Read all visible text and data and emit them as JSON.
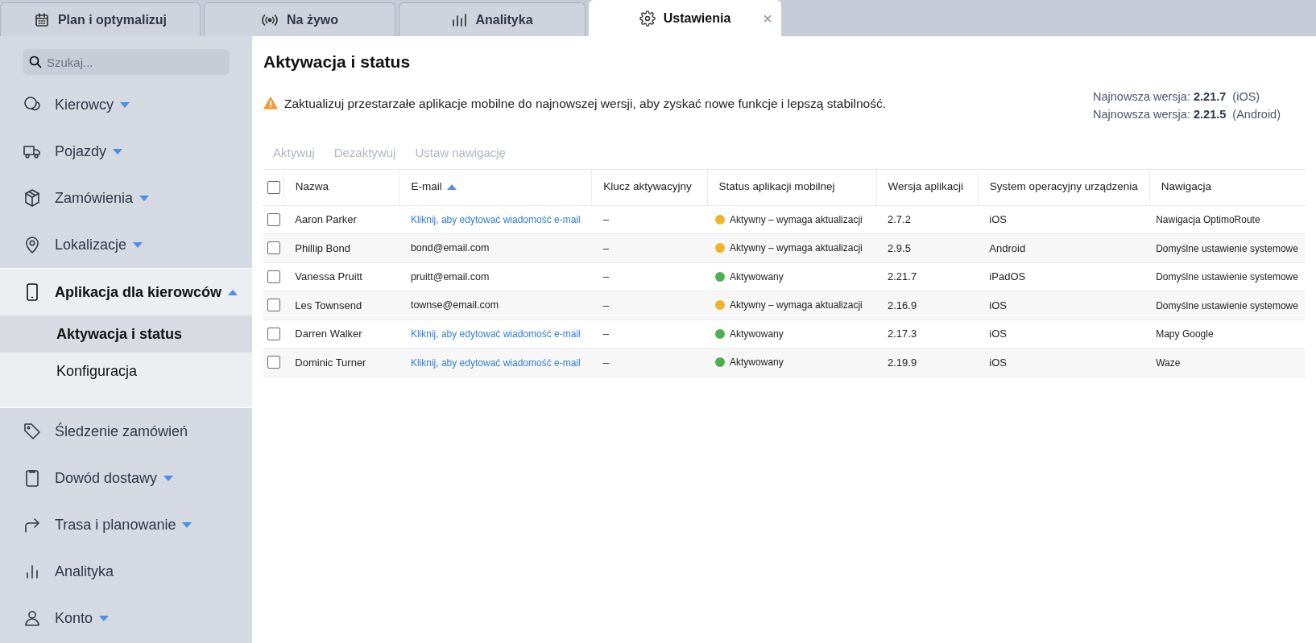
{
  "tabs": [
    {
      "label": "Plan i optymalizuj",
      "selected": false
    },
    {
      "label": "Na żywo",
      "selected": false
    },
    {
      "label": "Analityka",
      "selected": false
    },
    {
      "label": "Ustawienia",
      "selected": true,
      "close": "×"
    }
  ],
  "sidebar": {
    "search": {
      "placeholder": "Szukaj..."
    },
    "items": [
      {
        "label": "Kierowcy",
        "submenu": true,
        "expanded": false
      },
      {
        "label": "Pojazdy",
        "submenu": true,
        "expanded": false
      },
      {
        "label": "Zamówienia",
        "submenu": true,
        "expanded": false
      },
      {
        "label": "Lokalizacje",
        "submenu": true,
        "expanded": false
      },
      {
        "label": "Aplikacja dla kierowców",
        "submenu": true,
        "expanded": true,
        "children": [
          {
            "label": "Aktywacja i status",
            "selected": true
          },
          {
            "label": "Konfiguracja",
            "selected": false
          }
        ]
      },
      {
        "label": "Śledzenie zamówień",
        "submenu": false,
        "expanded": false
      },
      {
        "label": "Dowód dostawy",
        "submenu": true,
        "expanded": false
      },
      {
        "label": "Trasa i planowanie",
        "submenu": true,
        "expanded": false
      },
      {
        "label": "Analityka",
        "submenu": false,
        "expanded": false
      },
      {
        "label": "Konto",
        "submenu": true,
        "expanded": false
      }
    ]
  },
  "page": {
    "title": "Aktywacja i status",
    "warning": "Zaktualizuj przestarzałe aplikacje mobilne do najnowszej wersji, aby zyskać nowe funkcje i lepszą stabilność.",
    "versions": [
      "Najnowsza wersja: **2.21.7** (iOS)",
      "Najnowsza wersja: **2.21.5** (Android)"
    ],
    "actions": [
      {
        "label": "Aktywuj",
        "disabled": true
      },
      {
        "label": "Dezaktywuj",
        "disabled": true
      },
      {
        "label": "Ustaw nawigację",
        "disabled": true
      }
    ]
  },
  "table": {
    "select_all_checked": false,
    "columns": [
      {
        "label": "Nazwa",
        "sorted": false
      },
      {
        "label": "E-mail",
        "sorted": true
      },
      {
        "label": "Klucz aktywacyjny",
        "sorted": false
      },
      {
        "label": "Status aplikacji mobilnej",
        "sorted": false
      },
      {
        "label": "Wersja aplikacji",
        "sorted": false
      },
      {
        "label": "System operacyjny urządzenia",
        "sorted": false
      },
      {
        "label": "Nawigacja",
        "sorted": false
      }
    ],
    "rows": [
      {
        "checked": false,
        "name": "Aaron Parker",
        "email": {
          "text": "Kliknij, aby edytować wiadomość e-mail",
          "kind": "link"
        },
        "key": "–",
        "status": "Aktywny – wymaga aktualizacji",
        "color": "#f0b429",
        "version": "2.7.2",
        "os": "iOS",
        "navigation": "Nawigacja OptimoRoute"
      },
      {
        "checked": false,
        "name": "Phillip Bond",
        "email": {
          "text": "bond@email.com",
          "kind": "text"
        },
        "key": "–",
        "status": "Aktywny – wymaga aktualizacji",
        "color": "#f0b429",
        "version": "2.9.5",
        "os": "Android",
        "navigation": "Domyślne ustawienie systemowe"
      },
      {
        "checked": false,
        "name": "Vanessa Pruitt",
        "email": {
          "text": "pruitt@email.com",
          "kind": "text"
        },
        "key": "–",
        "status": "Aktywowany",
        "color": "#4caf50",
        "version": "2.21.7",
        "os": "iPadOS",
        "navigation": "Domyślne ustawienie systemowe"
      },
      {
        "checked": false,
        "name": "Les Townsend",
        "email": {
          "text": "townse@email.com",
          "kind": "text"
        },
        "key": "–",
        "status": "Aktywny – wymaga aktualizacji",
        "color": "#f0b429",
        "version": "2.16.9",
        "os": "iOS",
        "navigation": "Domyślne ustawienie systemowe"
      },
      {
        "checked": false,
        "name": "Darren Walker",
        "email": {
          "text": "Kliknij, aby edytować wiadomość e-mail",
          "kind": "link"
        },
        "key": "–",
        "status": "Aktywowany",
        "color": "#4caf50",
        "version": "2.17.3",
        "os": "iOS",
        "navigation": "Mapy Google"
      },
      {
        "checked": false,
        "name": "Dominic Turner",
        "email": {
          "text": "Kliknij, aby edytować wiadomość e-mail",
          "kind": "link"
        },
        "key": "–",
        "status": "Aktywowany",
        "color": "#4caf50",
        "version": "2.19.9",
        "os": "iOS",
        "navigation": "Waze"
      }
    ]
  }
}
